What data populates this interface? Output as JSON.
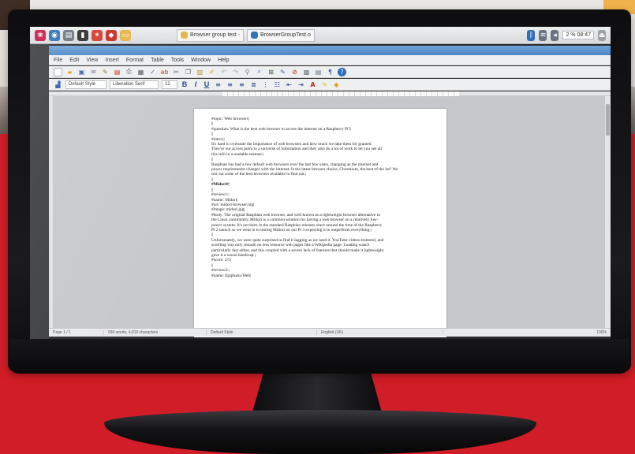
{
  "taskbar": {
    "tasks": [
      "Browser group test - ",
      "BrowserGroupTest.o"
    ],
    "clock": "2 % 08:47"
  },
  "writer": {
    "menu": [
      "File",
      "Edit",
      "View",
      "Insert",
      "Format",
      "Table",
      "Tools",
      "Window",
      "Help"
    ],
    "paragraph_style": "Default Style",
    "font_name": "Liberation Serif",
    "font_size": "12"
  },
  "document": {
    "lines": [
      "#topic: Web browsers|",
      "||",
      "#question: What is the best web browser to access the internet on a Raspberry Pi?|",
      "||",
      "#intro:||",
      "It's hard to overstate the importance of web browsers and how much we take them for granted.",
      "They're our access point to a universe of information and they also do a lot of work to let you see all",
      "this info in a readable manner.|",
      "||",
      "Raspbian has had a few default web browsers over the last few years, changing as the internet and",
      "power requirements changes with the internet. Is the latest browser choice, Chromium, the best of the lot? We",
      "test out some of the best browsers available to find out.|",
      "||",
      "#Midori#|",
      "||",
      "#review1:|",
      "#name: Midori|",
      "#url: midori-browser.org|",
      "#image: midori.jpg|",
      "#body: The original Raspbian web browser, and well known as a lightweight browser alternative in",
      "the Linux community, Midori is a common solution for having a web browser on a relatively low-",
      "power system. It's not been in the standard Raspbian releases since around the time of the Raspberry",
      "Pi 2 launch so we went in to testing Midori on our Pi 3 expecting it to outperform everything.|",
      "||",
      "Unfortunately, we were quite surprised to find it lagging as we used it. YouTube videos stuttered, and",
      "scrolling was only smooth on less resource web pages like a Wikipedia page. Loading wasn't",
      "particularly fast either, and this coupled with a severe lack of features that should make it lightweight",
      "gave it a worse handicap.|",
      "#score: 2/5|",
      "||",
      "#review2:|",
      "#name: Epiphany/Web|"
    ]
  },
  "status": {
    "page": "Page 1 / 1",
    "words": "936 words, 4,816 characters",
    "style": "Default Style",
    "language": "English (UK)",
    "zoom": "100%"
  },
  "colors": {
    "background_red": "#d11d27",
    "titlebar": "#4a86c5"
  }
}
